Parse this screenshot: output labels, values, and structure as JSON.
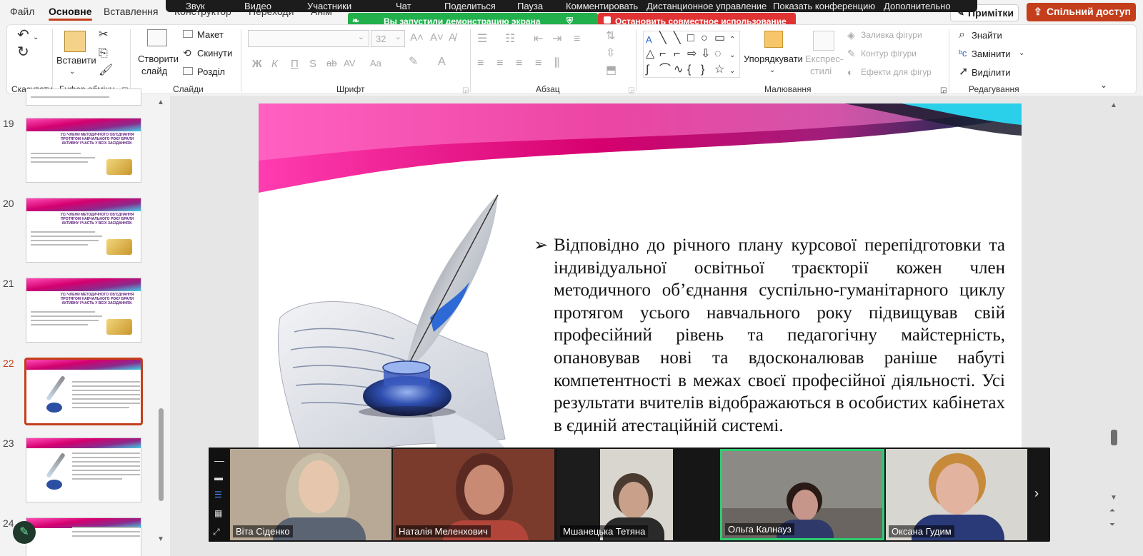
{
  "menu": {
    "tabs": [
      "Файл",
      "Основне",
      "Вставлення",
      "Конструктор",
      "Переходи",
      "Анім"
    ],
    "active": "Основне",
    "design_button": "Примітки",
    "share_button": "Спільний доступ"
  },
  "zoom": {
    "toolbar": [
      "Звук",
      "Видео",
      "Участники",
      "Чат",
      "Поделиться",
      "Пауза",
      "Комментировать",
      "Дистанционное управление",
      "Показать конференцию",
      "Дополнительно"
    ],
    "sharing_notice": "Вы запустили демонстрацию экрана",
    "stop_sharing": "Остановить совместное использование"
  },
  "ribbon": {
    "undo": {
      "label": "Скасувати"
    },
    "clipboard": {
      "paste": "Вставити",
      "label": "Буфер обміну"
    },
    "slides": {
      "new_slide_1": "Створити",
      "new_slide_2": "слайд",
      "layout": "Макет",
      "reset": "Скинути",
      "section": "Розділ",
      "label": "Слайди"
    },
    "font": {
      "font_name": "",
      "font_size": "32",
      "bold": "Ж",
      "italic": "К",
      "underline": "П",
      "strike": "S",
      "strike2": "ab",
      "label": "Шрифт"
    },
    "paragraph": {
      "label": "Абзац"
    },
    "drawing": {
      "arrange": "Упорядкувати",
      "quick_styles_1": "Експрес-",
      "quick_styles_2": "стилі",
      "fill": "Заливка фігури",
      "outline": "Контур фігури",
      "effects": "Ефекти для фігур",
      "label": "Малювання"
    },
    "editing": {
      "find": "Знайти",
      "replace": "Замінити",
      "select": "Виділити",
      "label": "Редагування"
    }
  },
  "slides": [
    {
      "number": "19",
      "title": "УСІ ЧЛЕНИ МЕТОДИЧНОГО ОБ'ЄДНАННЯ ПРОТЯГОМ НАВЧАЛЬНОГО РОКУ БРАЛИ АКТИВНУ УЧАСТЬ У ВСІХ ЗАСІДАННЯХ:"
    },
    {
      "number": "20",
      "title": "УСІ ЧЛЕНИ МЕТОДИЧНОГО ОБ'ЄДНАННЯ ПРОТЯГОМ НАВЧАЛЬНОГО РОКУ БРАЛИ АКТИВНУ УЧАСТЬ У ВСІХ ЗАСІДАННЯХ:"
    },
    {
      "number": "21",
      "title": "УСІ ЧЛЕНИ МЕТОДИЧНОГО ОБ'ЄДНАННЯ ПРОТЯГОМ НАВЧАЛЬНОГО РОКУ БРАЛИ АКТИВНУ УЧАСТЬ У ВСІХ ЗАСІДАННЯХ:"
    },
    {
      "number": "22",
      "title": ""
    },
    {
      "number": "23",
      "title": ""
    },
    {
      "number": "24",
      "title": ""
    }
  ],
  "current_slide": {
    "bullet": "➢",
    "text": "Відповідно до річного плану курсової перепідготовки та індивідуальної освітньої траєкторії кожен член методичного об’єднання суспільно-гуманітарного циклу протягом усього навчального року підвищував свій професійний рівень та педагогічну майстерність, опановував нові та вдосконалював раніше набуті компетентності в межах своєї професійної діяльності. Усі результати вчителів відображаються в особистих кабінетах в єдиній атестаційній системі."
  },
  "participants": [
    {
      "name": "Віта Сіденко",
      "bg": "#b7a995"
    },
    {
      "name": "Наталія Меленхович",
      "bg": "#7a3a2c"
    },
    {
      "name": "Мшанецька Тетяна",
      "bg": "#d9d6cf"
    },
    {
      "name": "Ольга Калнауз",
      "bg": "#8c8a84"
    },
    {
      "name": "Оксана Гудим",
      "bg": "#d8d6d0"
    }
  ],
  "colors": {
    "accent": "#c43e1c",
    "zoom_green": "#22b04d",
    "zoom_red": "#e03434",
    "active_speaker": "#2ecc71"
  }
}
